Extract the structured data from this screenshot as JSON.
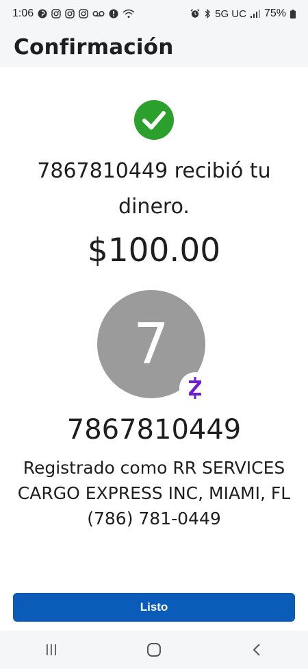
{
  "status_bar": {
    "time": "1:06",
    "network": "5G UC",
    "battery": "75%",
    "left_icons": [
      "pinterest-icon",
      "instagram-icon",
      "instagram-icon",
      "instagram-icon",
      "voicemail-icon",
      "alert-icon",
      "wifi-calling-icon"
    ],
    "right_icons": [
      "alarm-icon",
      "bluetooth-icon",
      "signal-icon",
      "battery-icon"
    ]
  },
  "header": {
    "title": "Confirmación"
  },
  "confirmation": {
    "message": "7867810449 recibió tu dinero.",
    "amount": "$100.00",
    "avatar_letter": "7",
    "recipient_name": "7867810449",
    "registered_line1": "Registrado como RR SERVICES",
    "registered_line2": "CARGO EXPRESS INC, MIAMI, FL",
    "phone": "(786) 781-0449"
  },
  "actions": {
    "done_label": "Listo"
  },
  "colors": {
    "success_green": "#2ca02c",
    "zelle_purple": "#6d1ed4",
    "button_blue": "#0a5cb8",
    "avatar_gray": "#9b9b9b"
  },
  "nav": {
    "icons": [
      "recents-icon",
      "home-icon",
      "back-icon"
    ]
  }
}
